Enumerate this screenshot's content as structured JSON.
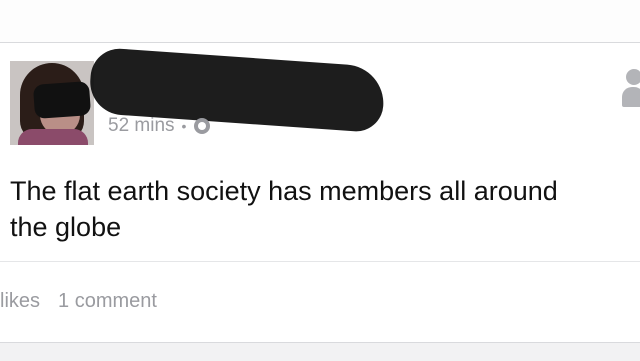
{
  "post": {
    "author_name": "",
    "timestamp": "52 mins",
    "separator": "•",
    "privacy_icon": "globe-icon",
    "text_line1": "The flat earth society has members all around",
    "text_line2": "the globe",
    "likes_label": "likes",
    "comments_label": "1 comment"
  },
  "colors": {
    "text": "#111111",
    "muted": "#9a9ba0",
    "divider": "#e5e6e8"
  }
}
